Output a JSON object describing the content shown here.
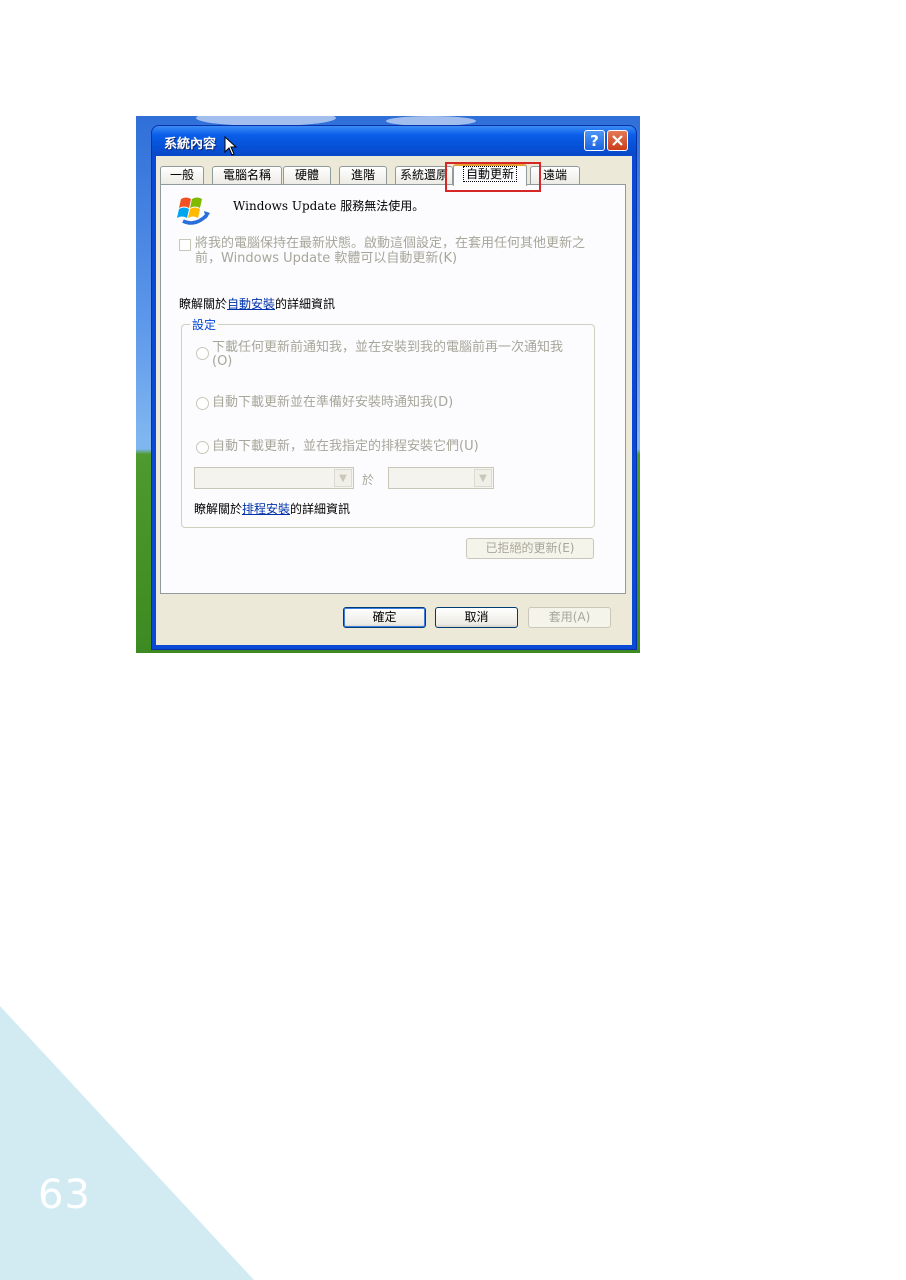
{
  "dialog": {
    "title": "系統內容",
    "tabs": [
      "一般",
      "電腦名稱",
      "硬體",
      "進階",
      "系統還原",
      "自動更新",
      "遠端"
    ],
    "active_tab": "自動更新",
    "status": "Windows Update 服務無法使用。",
    "keep_checkbox_label": "將我的電腦保持在最新狀態。啟動這個設定，在套用任何其他更新之前，Windows Update 軟體可以自動更新(K)",
    "learn_auto": {
      "prefix": "瞭解關於",
      "link": "自動安裝",
      "suffix": "的詳細資訊"
    },
    "settings_group": "設定",
    "options": [
      "下載任何更新前通知我，並在安裝到我的電腦前再一次通知我(O)",
      "自動下載更新並在準備好安裝時通知我(D)",
      "自動下載更新，並在我指定的排程安裝它們(U)"
    ],
    "at_label": "於",
    "learn_schedule": {
      "prefix": "瞭解關於",
      "link": "排程安裝",
      "suffix": "的詳細資訊"
    },
    "declined_button": "已拒絕的更新(E)",
    "ok_button": "確定",
    "cancel_button": "取消",
    "apply_button": "套用(A)"
  },
  "page_number": "63",
  "colors": {
    "corner": "#d2ebf3",
    "highlight": "#d62626",
    "xp_title": "#0a5ee8"
  }
}
